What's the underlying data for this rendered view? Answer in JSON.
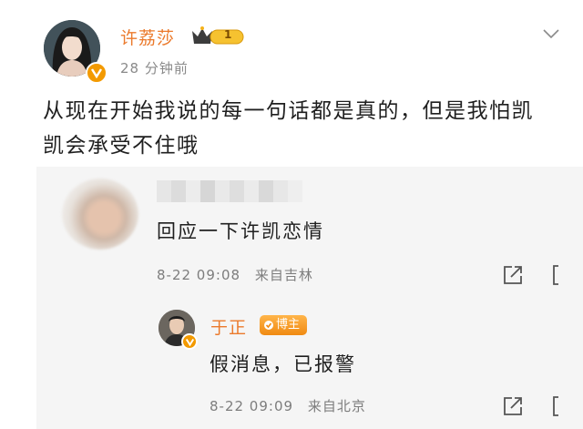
{
  "post": {
    "author": "许荔莎",
    "vip_level": "1",
    "time_ago": "28 分钟前",
    "text": "从现在开始我说的每一句话都是真的，但是我怕凯凯会承受不住哦"
  },
  "comment": {
    "text": "回应一下许凯恋情",
    "date": "8-22 09:08",
    "location": "来自吉林"
  },
  "reply": {
    "author": "于正",
    "badge": "博主",
    "text": "假消息，已报警",
    "date": "8-22 09:09",
    "location": "来自北京"
  },
  "icons": {
    "verified": "verified-v-icon",
    "crown": "crown-icon",
    "menu": "chevron-down-icon",
    "share": "share-icon",
    "comment": "comment-icon"
  },
  "colors": {
    "name_orange": "#eb7a2c",
    "badge_orange": "#f39a00",
    "panel_bg": "#f5f5f5",
    "meta_gray": "#7d7d7d"
  }
}
